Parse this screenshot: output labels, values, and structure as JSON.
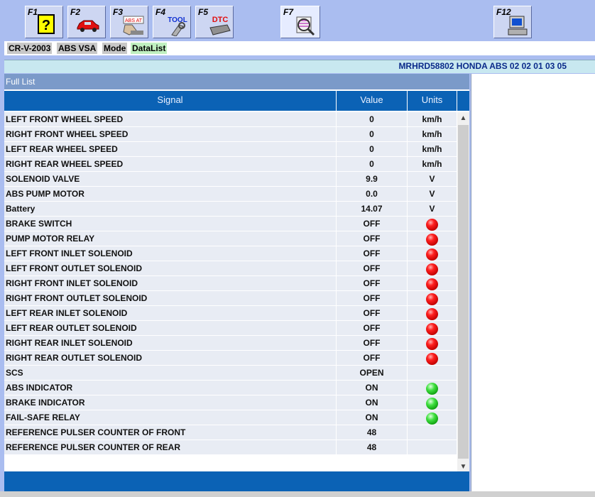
{
  "toolbar": {
    "buttons": [
      {
        "key": "F1",
        "icon": "help-icon"
      },
      {
        "key": "F2",
        "icon": "car-icon"
      },
      {
        "key": "F3",
        "icon": "abs-at-icon"
      },
      {
        "key": "F4",
        "icon": "tool-icon"
      },
      {
        "key": "F5",
        "icon": "dtc-icon"
      },
      {
        "key": "F7",
        "icon": "datalist-icon"
      },
      {
        "key": "F12",
        "icon": "computer-icon"
      }
    ],
    "tool_text": "TOOL",
    "dtc_text": "DTC",
    "abs_text": "ABS AT"
  },
  "breadcrumb": [
    "CR-V-2003",
    "ABS VSA",
    "Mode",
    "DataList"
  ],
  "ecu_id": "MRHRD58802  HONDA ABS  02 02 01 03 05",
  "list_title": "Full List",
  "columns": {
    "signal": "Signal",
    "value": "Value",
    "units": "Units"
  },
  "rows": [
    {
      "signal": "LEFT FRONT WHEEL SPEED",
      "value": "0",
      "unit": "km/h"
    },
    {
      "signal": "RIGHT FRONT WHEEL SPEED",
      "value": "0",
      "unit": "km/h"
    },
    {
      "signal": "LEFT REAR WHEEL SPEED",
      "value": "0",
      "unit": "km/h"
    },
    {
      "signal": "RIGHT REAR WHEEL SPEED",
      "value": "0",
      "unit": "km/h"
    },
    {
      "signal": "SOLENOID VALVE",
      "value": "9.9",
      "unit": "V"
    },
    {
      "signal": "ABS PUMP MOTOR",
      "value": "0.0",
      "unit": "V"
    },
    {
      "signal": "Battery",
      "value": "14.07",
      "unit": "V"
    },
    {
      "signal": "BRAKE SWITCH",
      "value": "OFF",
      "led": "red"
    },
    {
      "signal": "PUMP MOTOR RELAY",
      "value": "OFF",
      "led": "red"
    },
    {
      "signal": "LEFT FRONT INLET SOLENOID",
      "value": "OFF",
      "led": "red"
    },
    {
      "signal": "LEFT FRONT OUTLET SOLENOID",
      "value": "OFF",
      "led": "red"
    },
    {
      "signal": "RIGHT FRONT INLET SOLENOID",
      "value": "OFF",
      "led": "red"
    },
    {
      "signal": "RIGHT FRONT OUTLET SOLENOID",
      "value": "OFF",
      "led": "red"
    },
    {
      "signal": "LEFT REAR INLET SOLENOID",
      "value": "OFF",
      "led": "red"
    },
    {
      "signal": "LEFT REAR OUTLET SOLENOID",
      "value": "OFF",
      "led": "red"
    },
    {
      "signal": "RIGHT REAR INLET SOLENOID",
      "value": "OFF",
      "led": "red"
    },
    {
      "signal": "RIGHT REAR OUTLET SOLENOID",
      "value": "OFF",
      "led": "red"
    },
    {
      "signal": "SCS",
      "value": "OPEN",
      "unit": ""
    },
    {
      "signal": "ABS INDICATOR",
      "value": "ON",
      "led": "green"
    },
    {
      "signal": "BRAKE INDICATOR",
      "value": "ON",
      "led": "green"
    },
    {
      "signal": "FAIL-SAFE RELAY",
      "value": "ON",
      "led": "green"
    },
    {
      "signal": "REFERENCE PULSER COUNTER OF FRONT",
      "value": "48",
      "unit": ""
    },
    {
      "signal": "REFERENCE PULSER COUNTER OF REAR",
      "value": "48",
      "unit": ""
    }
  ],
  "colors": {
    "header_blue": "#0b62b5",
    "toolbar_bg": "#aabdf0",
    "led_red": "#ff2020",
    "led_green": "#20d020"
  }
}
